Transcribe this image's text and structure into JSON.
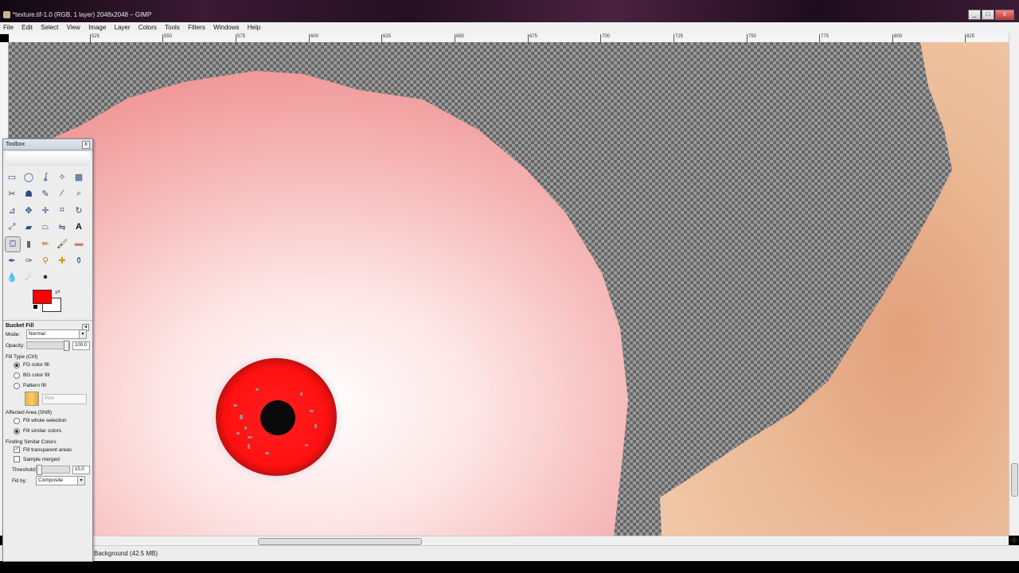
{
  "window": {
    "title": "*texture.tif-1.0 (RGB, 1 layer) 2048x2048 – GIMP",
    "controls": [
      "_",
      "□",
      "x"
    ]
  },
  "menubar": {
    "items": [
      "File",
      "Edit",
      "Select",
      "View",
      "Image",
      "Layer",
      "Colors",
      "Tools",
      "Filters",
      "Windows",
      "Help"
    ]
  },
  "ruler": {
    "ticks": [
      "525",
      "550",
      "575",
      "600",
      "625",
      "650",
      "675",
      "700",
      "725",
      "750",
      "775",
      "800",
      "825"
    ]
  },
  "toolbox": {
    "title": "Toolbox",
    "close_glyph": "x",
    "tools": [
      "rect-select",
      "ellipse-select",
      "free-select",
      "fuzzy-select",
      "select-by-color",
      "scissors-select",
      "foreground-select",
      "paths",
      "color-picker",
      "zoom",
      "measure",
      "move",
      "align",
      "crop",
      "rotate",
      "scale",
      "shear",
      "perspective",
      "flip",
      "text",
      "bucket-fill",
      "blend",
      "pencil",
      "paintbrush",
      "eraser",
      "airbrush",
      "ink",
      "clone",
      "heal",
      "perspective-clone",
      "smudge",
      "dodge-burn",
      "blur-sharpen"
    ],
    "fg_color": "#ff0000",
    "bg_color": "#ffffff"
  },
  "tool_options": {
    "title": "Bucket Fill",
    "mode_label": "Mode:",
    "mode_value": "Normal",
    "opacity_label": "Opacity:",
    "opacity_value": "100.0",
    "fill_type_label": "Fill Type  (Ctrl)",
    "fill_type_options": [
      "FG color fill",
      "BG color fill",
      "Pattern fill"
    ],
    "fill_type_selected": 0,
    "pattern_name": "Pine",
    "affected_area_label": "Affected Area  (Shift)",
    "affected_area_options": [
      "Fill whole selection",
      "Fill similar colors"
    ],
    "affected_area_selected": 1,
    "finding_label": "Finding Similar Colors",
    "fill_transparent_label": "Fill transparent areas",
    "fill_transparent_checked": true,
    "sample_merged_label": "Sample merged",
    "sample_merged_checked": false,
    "threshold_label": "Threshold:",
    "threshold_value": "15.0",
    "fill_by_label": "Fill by:",
    "fill_by_value": "Composite"
  },
  "status": {
    "text": "Background (42.5 MB)"
  },
  "colors": {
    "skin_pink": "#f2a0a0",
    "skin_tan": "#e8b088",
    "iris_red": "#ff1a1a",
    "checker_dark": "#666666",
    "checker_light": "#9a9a9a"
  }
}
